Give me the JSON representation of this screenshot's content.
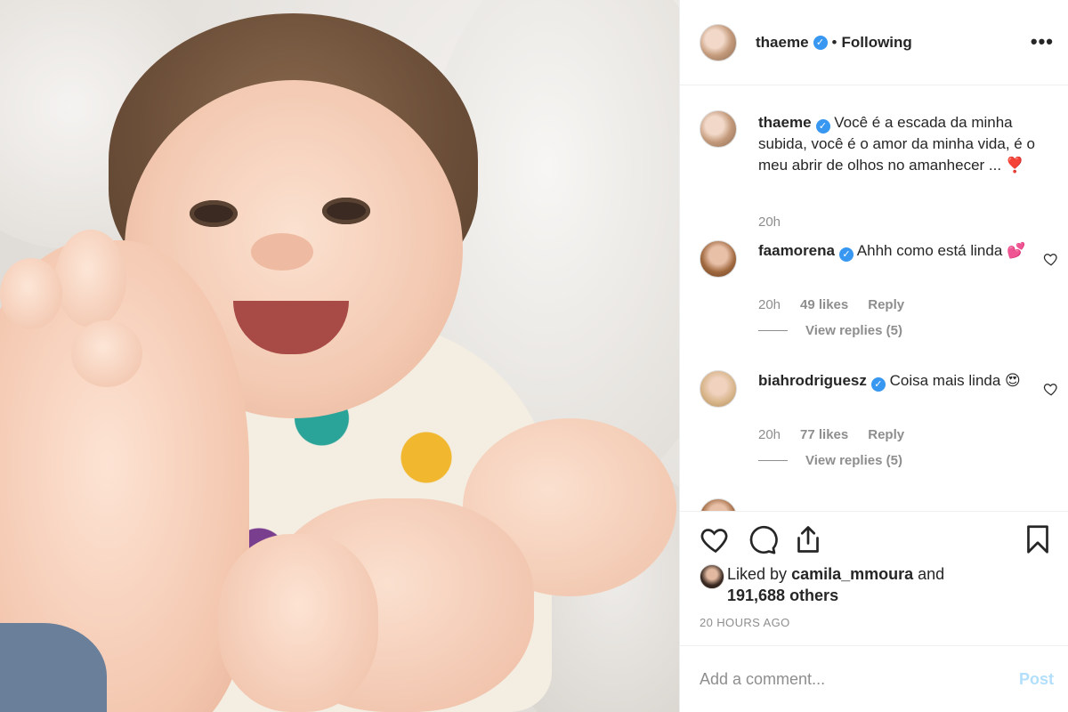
{
  "photo": {
    "alt": ""
  },
  "header": {
    "username": "thaeme",
    "dot": "•",
    "following": "Following",
    "more": "•••"
  },
  "caption": {
    "username": "thaeme",
    "text": "Você é a escada da minha subida, você é o amor da minha vida, é o meu abrir de olhos no amanhecer ... ❣️",
    "time": "20h"
  },
  "comments": [
    {
      "username": "faamorena",
      "text": "Ahhh como está linda 💕",
      "time": "20h",
      "likes": "49 likes",
      "reply": "Reply",
      "view_replies": "View replies (5)"
    },
    {
      "username": "biahrodriguesz",
      "text": "Coisa mais linda 😍",
      "time": "20h",
      "likes": "77 likes",
      "reply": "Reply",
      "view_replies": "View replies (5)"
    }
  ],
  "actions": {
    "like": "heart-icon",
    "comment": "comment-icon",
    "share": "share-icon",
    "save": "bookmark-icon"
  },
  "likes": {
    "prefix": "Liked by",
    "user": "camila_mmoura",
    "and": "and",
    "others": "191,688 others"
  },
  "timestamp": "20 HOURS AGO",
  "add_comment": {
    "placeholder": "Add a comment...",
    "post": "Post"
  },
  "colors": {
    "verified": "#3897f0",
    "post_disabled": "#b2dffc",
    "muted": "#8e8e8e"
  }
}
